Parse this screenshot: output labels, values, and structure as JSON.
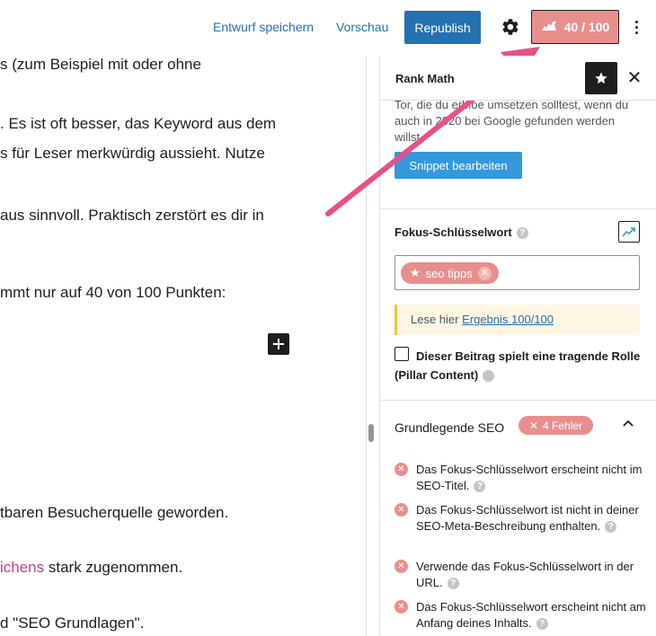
{
  "toolbar": {
    "save_draft_label": "Entwurf speichern",
    "preview_label": "Vorschau",
    "republish_label": "Republish",
    "score_label": "40 / 100"
  },
  "editor": {
    "lines": [
      "s (zum Beispiel mit oder ohne",
      ". Es ist oft besser, das Keyword aus dem",
      "s für Leser merkwürdig aussieht. Nutze",
      "aus sinnvoll. Praktisch zerstört es dir in",
      "mmt nur auf 40 von 100 Punkten:",
      "tbaren Besucherquelle geworden.",
      "d \"SEO Grundlagen\"."
    ],
    "pink_line": {
      "pink": "ichens",
      "rest": " stark zugenommen."
    }
  },
  "sidebar": {
    "title": "Rank Math",
    "snippet_text": "Tor, die du erbloe umsetzen solltest, wenn du auch in 2020 bei Google gefunden werden willst.",
    "snippet_button": "Snippet bearbeiten",
    "focus_label": "Fokus-Schlüsselwort",
    "help_glyph": "?",
    "keyword": "seo tipps",
    "notice_prefix": "Lese hier ",
    "notice_link": "Ergebnis 100/100",
    "pillar_label": "Dieser Beitrag spielt eine tragende Rolle (Pillar Content)",
    "seo_section_title": "Grundlegende SEO",
    "error_badge": "4 Fehler",
    "checks": [
      "Das Fokus-Schlüsselwort erscheint nicht im SEO-Titel.",
      "Das Fokus-Schlüsselwort ist nicht in deiner SEO-Meta-Beschreibung enthalten.",
      "Verwende das Fokus-Schlüsselwort in der URL.",
      "Das Fokus-Schlüsselwort erscheint nicht am Anfang deines Inhalts."
    ]
  },
  "colors": {
    "accent_blue": "#2271b1",
    "score_red": "#e88f8e",
    "arrow_pink": "#e8508a",
    "snippet_blue": "#3498db"
  }
}
